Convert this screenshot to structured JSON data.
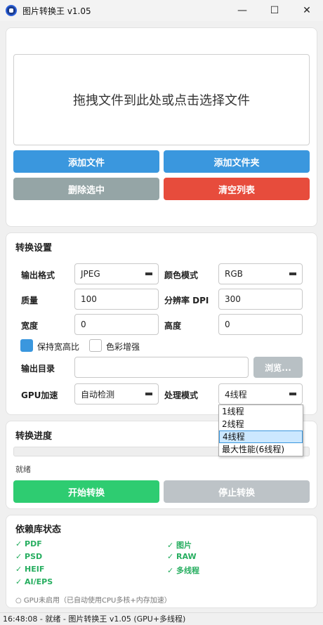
{
  "window": {
    "title": "图片转换王 v1.05"
  },
  "files": {
    "dropzone_text": "拖拽文件到此处或点击选择文件",
    "add_file": "添加文件",
    "add_folder": "添加文件夹",
    "delete_selected": "删除选中",
    "clear_list": "清空列表"
  },
  "settings": {
    "title": "转换设置",
    "output_format_label": "输出格式",
    "output_format_value": "JPEG",
    "color_mode_label": "颜色模式",
    "color_mode_value": "RGB",
    "quality_label": "质量",
    "quality_value": "100",
    "dpi_label": "分辨率 DPI",
    "dpi_value": "300",
    "width_label": "宽度",
    "width_value": "0",
    "height_label": "高度",
    "height_value": "0",
    "keep_ratio_label": "保持宽高比",
    "keep_ratio_checked": true,
    "color_enhance_label": "色彩增强",
    "color_enhance_checked": false,
    "output_dir_label": "输出目录",
    "output_dir_value": "",
    "browse_label": "浏览...",
    "gpu_label": "GPU加速",
    "gpu_value": "自动检测",
    "mode_label": "处理模式",
    "mode_value": "4线程",
    "mode_options": [
      "1线程",
      "2线程",
      "4线程",
      "最大性能(6线程)"
    ],
    "mode_selected_index": 2
  },
  "progress": {
    "title": "转换进度",
    "value": 0,
    "status": "就绪",
    "start_label": "开始转换",
    "stop_label": "停止转换"
  },
  "deps": {
    "title": "依赖库状态",
    "left": [
      "✓ PDF",
      "✓ PSD",
      "✓ HEIF",
      "✓ AI/EPS"
    ],
    "right": [
      "✓ 图片",
      "✓ RAW",
      "✓ 多线程"
    ],
    "note": "○ GPU未启用（已自动使用CPU多核+内存加速）"
  },
  "statusbar": {
    "text": "16:48:08 - 就绪 - 图片转换王 v1.05 (GPU+多线程)"
  },
  "colors": {
    "blue": "#3a97de",
    "red": "#e74c3c",
    "green": "#2ecc71",
    "gray": "#95a5a6",
    "check_green": "#27ae60"
  }
}
